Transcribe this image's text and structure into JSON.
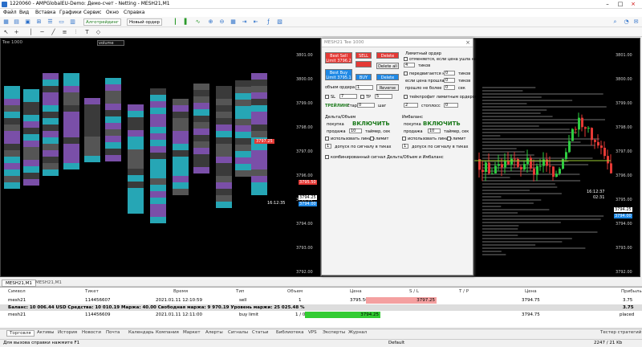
{
  "window": {
    "title": "1220060 - AMPGlobalEU-Demo: Демо-счет - Netting - MESH21,M1"
  },
  "menu": [
    "Файл",
    "Вид",
    "Вставка",
    "Графики",
    "Сервис",
    "Окно",
    "Справка"
  ],
  "toolbar": {
    "algo_label": "Алготрейдинг",
    "new_order_label": "Новый ордер"
  },
  "left_chart": {
    "header": "Tee  1000",
    "volume_select": "volume",
    "scale": [
      "3801.00",
      "3800.00",
      "3799.00",
      "3798.00",
      "3797.00",
      "3796.00",
      "3795.00",
      "3794.00",
      "3793.00",
      "3792.00"
    ],
    "markers": [
      "3797.25",
      "3795.50",
      "3794.25",
      "3794.00",
      "16:12:35"
    ]
  },
  "right_chart": {
    "scale": [
      "3801.00",
      "3800.00",
      "3799.00",
      "3798.00",
      "3797.00",
      "3796.00",
      "3795.00",
      "3794.00",
      "3793.00",
      "3792.00"
    ],
    "markers": [
      "3794.25",
      "3794.00",
      "16:12:37",
      "02:31"
    ]
  },
  "dialog": {
    "title": "MESH21  Tee  1000",
    "best_sell": "Best Sell",
    "best_sell_price": "Limit 3796.2",
    "sell": "SELL",
    "delete": "Delete",
    "delete_all": "Delete all",
    "best_buy": "Best Buy",
    "best_buy_price": "Limit 3795.1",
    "buy": "BUY",
    "lot_label": "объем ордера",
    "lot": "1",
    "reverse": "Reverse",
    "sl": "SL",
    "sl_val": "7",
    "tp": "TP",
    "tp_val": "5",
    "trailing": "ТРЕЙЛИНГ",
    "start": "старт",
    "start_val": "0",
    "step": "шаг",
    "step_val": "2",
    "stoploss": "стоплосс",
    "stoploss_val": "0",
    "limit_order": "Лимитный ордер",
    "opt1": "отменяется, если цена ушла на",
    "opt1_val": "4",
    "ticks": "тиков",
    "opt2": "передвигается на",
    "opt2_val": "0",
    "ticks2": "тиков",
    "opt3": "если цена прошла",
    "opt3_val": "0",
    "ticks3": "тиков",
    "opt4": "прошло не более",
    "opt4_val": "0",
    "sec": "сек",
    "opt5": "тейкпрофит лимитным ордером",
    "delta_title": "Дельта/Объем",
    "imbalance_title": "Имбаланс",
    "buy_opt": "покупка",
    "sell_opt": "продажа",
    "enable": "ВКЛЮЧИТЬ",
    "enable2": "ВКЛЮЧИТЬ",
    "timer": "таймер, сек",
    "timer_val": "10",
    "timer_val2": "10",
    "use_line": "использовать линию",
    "limit_chk": "лимит",
    "tolerance": "допуск по сигналу в тиках",
    "tol_val": "1",
    "tol_val2": "1",
    "combined": "комбинированный сигнал Дельта/Объем и Имбаланс"
  },
  "chart_tabs": [
    "MESH21,M1",
    "MESH21,M1"
  ],
  "terminal": {
    "headers": [
      "Символ",
      "Тикет",
      "Время",
      "Тип",
      "Объем",
      "Цена",
      "S / L",
      "T / P",
      "Цена",
      "Прибыль"
    ],
    "rows": [
      {
        "symbol": "mesh21",
        "ticket": "114456607",
        "time": "2021.01.11 12:10:59",
        "type": "sell",
        "volume": "1",
        "price": "3795.50",
        "sl": "3797.25",
        "tp": "",
        "cur": "3794.75",
        "profit": "3.75"
      },
      {
        "summary": "Баланс: 10 006.44 USD  Средства: 10 010.19  Маржа: 40.00  Свободная маржа: 9 970.19  Уровень маржи: 25 025.48 %",
        "profit": "3.75"
      },
      {
        "symbol": "mesh21",
        "ticket": "114456609",
        "time": "2021.01.11 12:11:00",
        "type": "buy limit",
        "volume": "1 / 0",
        "price": "3794.25",
        "sl": "",
        "tp": "",
        "cur": "3794.75",
        "profit": "placed"
      }
    ]
  },
  "bottom_tabs": [
    "Торговля",
    "Активы",
    "История",
    "Новости",
    "Почта",
    "Календарь",
    "Компания",
    "Маркет",
    "Алерты",
    "Сигналы",
    "Статьи",
    "Библиотека",
    "VPS",
    "Эксперты",
    "Журнал"
  ],
  "status": {
    "help": "Для вызова справки нажмите F1",
    "profile": "Default",
    "traffic": "2247 / 21 Kb",
    "tester": "Тестер стратегий"
  },
  "colors": {
    "sell": "#e53935",
    "buy": "#1e88e5",
    "teal": "#26a6b5",
    "purple": "#7a4fa8",
    "gray": "#555"
  }
}
